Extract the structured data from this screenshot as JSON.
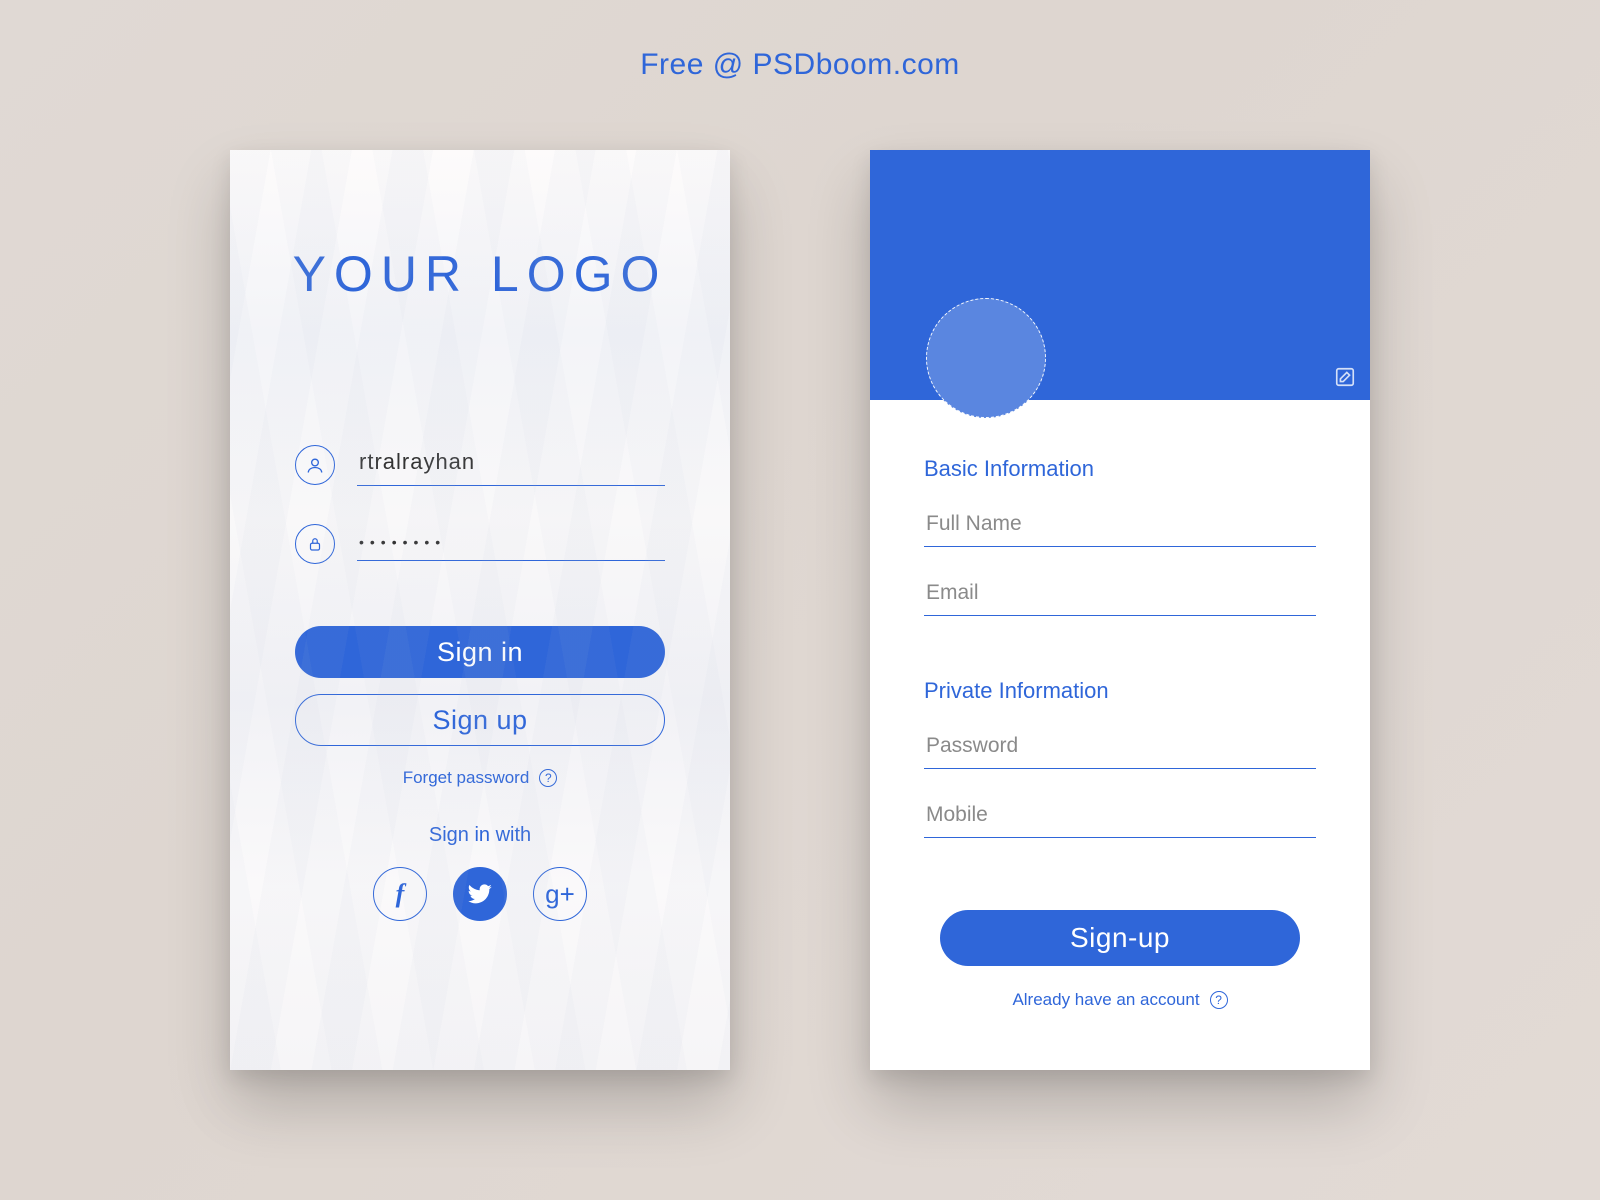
{
  "header": {
    "promo": "Free @ PSDboom.com"
  },
  "colors": {
    "accent": "#2f66d9"
  },
  "login": {
    "logo": "YOUR LOGO",
    "username_value": "rtralrayhan",
    "password_value": "••••••••",
    "signin_label": "Sign in",
    "signup_label": "Sign up",
    "forget_label": "Forget password",
    "help_glyph": "?",
    "social_label": "Sign in with",
    "socials": {
      "facebook": "f",
      "twitter": "",
      "google": "g+"
    }
  },
  "signup": {
    "section_basic": "Basic Information",
    "fullname_placeholder": "Full Name",
    "email_placeholder": "Email",
    "section_private": "Private Information",
    "password_placeholder": "Password",
    "mobile_placeholder": "Mobile",
    "signup_btn": "Sign-up",
    "already_label": "Already have an account",
    "help_glyph": "?"
  }
}
